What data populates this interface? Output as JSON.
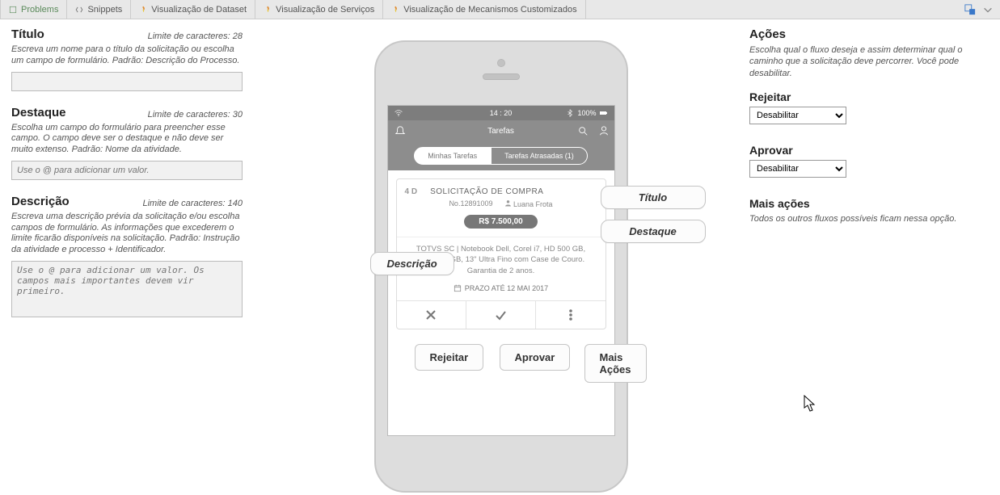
{
  "tabs": {
    "problems": "Problems",
    "snippets": "Snippets",
    "dataset": "Visualização de Dataset",
    "servicos": "Visualização de Serviços",
    "mecanismos": "Visualização de Mecanismos Customizados"
  },
  "left": {
    "titulo": {
      "title": "Título",
      "limit": "Limite de caracteres: 28",
      "help": "Escreva um nome para o título da solicitação ou escolha um campo de formulário. Padrão: Descrição do Processo.",
      "placeholder": ""
    },
    "destaque": {
      "title": "Destaque",
      "limit": "Limite de caracteres: 30",
      "help": "Escolha um campo do formulário para preencher esse campo. O campo deve ser o destaque e não deve ser muito extenso. Padrão: Nome da atividade.",
      "placeholder": "Use o @ para adicionar um valor."
    },
    "descricao": {
      "title": "Descrição",
      "limit": "Limite de caracteres: 140",
      "help": "Escreva uma descrição prévia da solicitação e/ou escolha campos de formulário. As informações que excederem o limite ficarão disponíveis na solicitação. Padrão: Instrução da atividade e processo + Identificador.",
      "placeholder": "Use o @ para adicionar um valor. Os campos mais importantes devem vir primeiro."
    }
  },
  "phone": {
    "status": {
      "time": "14 : 20",
      "battery": "100%"
    },
    "appbar": {
      "title": "Tarefas"
    },
    "pills": {
      "mine": "Minhas Tarefas",
      "late": "Tarefas Atrasadas (1)"
    },
    "card": {
      "duration": "4 D",
      "title": "SOLICITAÇÃO DE COMPRA",
      "number": "No.12891009",
      "user": "Luana Frota",
      "price": "R$ 7.500,00",
      "desc": "TOTVS SC | Notebook Dell, Corel i7, HD 500 GB, SSD 248 GB, 13\" Ultra Fino com Case de Couro. Garantia de 2 anos.",
      "due": "PRAZO ATÉ 12 MAI 2017"
    }
  },
  "callouts": {
    "titulo": "Título",
    "destaque": "Destaque",
    "descricao": "Descrição",
    "rejeitar": "Rejeitar",
    "aprovar": "Aprovar",
    "mais": "Mais Ações"
  },
  "right": {
    "acoes": {
      "title": "Ações",
      "help": "Escolha qual o fluxo deseja e assim determinar qual o caminho que a solicitação deve percorrer. Você pode desabilitar."
    },
    "rejeitar": {
      "title": "Rejeitar",
      "value": "Desabilitar"
    },
    "aprovar": {
      "title": "Aprovar",
      "value": "Desabilitar"
    },
    "mais": {
      "title": "Mais ações",
      "help": "Todos os outros fluxos possíveis ficam nessa opção."
    }
  }
}
